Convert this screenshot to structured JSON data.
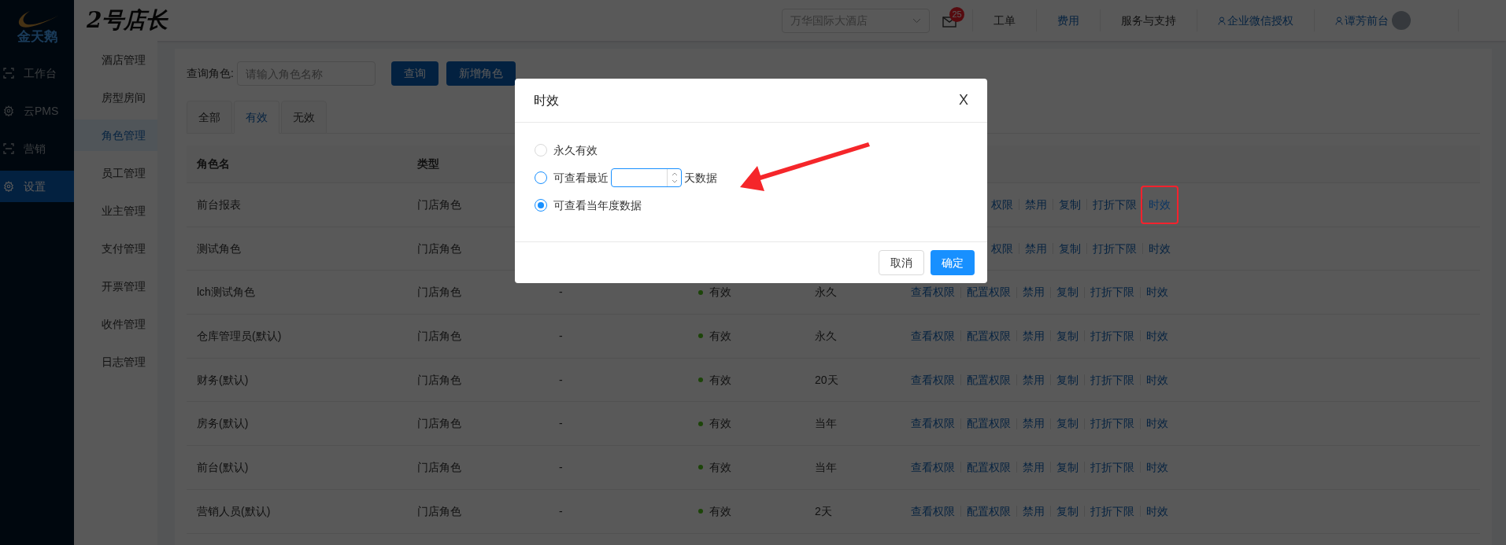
{
  "nav": {
    "logo_text": "金天鹅",
    "items": [
      {
        "label": "工作台",
        "kind": "scan",
        "selected": false
      },
      {
        "label": "云PMS",
        "kind": "gear",
        "selected": false
      },
      {
        "label": "营销",
        "kind": "scan",
        "selected": false
      },
      {
        "label": "设置",
        "kind": "gear",
        "selected": true
      }
    ]
  },
  "header": {
    "title": "2号店长",
    "hotel_select": "万华国际大酒店",
    "mail_badge": "25",
    "links": [
      {
        "label": "工单",
        "kind": "plain"
      },
      {
        "label": "费用",
        "kind": "link"
      },
      {
        "label": "服务与支持",
        "kind": "plain"
      },
      {
        "label": "企业微信授权",
        "kind": "user"
      },
      {
        "label": "谭芳前台",
        "kind": "user"
      }
    ]
  },
  "sub_menu": [
    {
      "label": "酒店管理",
      "selected": false
    },
    {
      "label": "房型房间",
      "selected": false
    },
    {
      "label": "角色管理",
      "selected": true
    },
    {
      "label": "员工管理",
      "selected": false
    },
    {
      "label": "业主管理",
      "selected": false
    },
    {
      "label": "支付管理",
      "selected": false
    },
    {
      "label": "开票管理",
      "selected": false
    },
    {
      "label": "收件管理",
      "selected": false
    },
    {
      "label": "日志管理",
      "selected": false
    }
  ],
  "search": {
    "label": "查询角色:",
    "placeholder": "请输入角色名称"
  },
  "buttons": [
    "查询",
    "新增角色"
  ],
  "tabs": [
    {
      "label": "全部",
      "selected": false
    },
    {
      "label": "有效",
      "selected": true
    },
    {
      "label": "无效",
      "selected": false
    }
  ],
  "table": {
    "columns": [
      "角色名",
      "类型"
    ],
    "rows": [
      {
        "name": "前台报表",
        "type": "门店角色",
        "actions": [
          {
            "label": "权限",
            "highlighted": false
          },
          {
            "label": "禁用",
            "highlighted": false
          },
          {
            "label": "复制",
            "highlighted": false
          },
          {
            "label": "打折下限",
            "highlighted": false
          },
          {
            "label": "时效",
            "highlighted": true
          }
        ]
      },
      {
        "name": "测试角色",
        "type": "门店角色",
        "actions": [
          {
            "label": "权限",
            "highlighted": false
          },
          {
            "label": "禁用",
            "highlighted": false
          },
          {
            "label": "复制",
            "highlighted": false
          },
          {
            "label": "打折下限",
            "highlighted": false
          },
          {
            "label": "时效",
            "highlighted": false
          }
        ]
      },
      {
        "name": "lch测试角色",
        "type": "门店角色",
        "column_3": "-",
        "status": "有效",
        "validity": "永久",
        "actions": [
          {
            "label": "查看权限",
            "highlighted": false
          },
          {
            "label": "配置权限",
            "highlighted": false
          },
          {
            "label": "禁用",
            "highlighted": false
          },
          {
            "label": "复制",
            "highlighted": false
          },
          {
            "label": "打折下限",
            "highlighted": false
          },
          {
            "label": "时效",
            "highlighted": false
          }
        ]
      },
      {
        "name": "仓库管理员(默认)",
        "type": "门店角色",
        "column_3": "-",
        "status": "有效",
        "validity": "永久",
        "actions": [
          {
            "label": "查看权限",
            "highlighted": false
          },
          {
            "label": "配置权限",
            "highlighted": false
          },
          {
            "label": "禁用",
            "highlighted": false
          },
          {
            "label": "复制",
            "highlighted": false
          },
          {
            "label": "打折下限",
            "highlighted": false
          },
          {
            "label": "时效",
            "highlighted": false
          }
        ]
      },
      {
        "name": "财务(默认)",
        "type": "门店角色",
        "column_3": "-",
        "status": "有效",
        "validity": "20天",
        "actions": [
          {
            "label": "查看权限",
            "highlighted": false
          },
          {
            "label": "配置权限",
            "highlighted": false
          },
          {
            "label": "禁用",
            "highlighted": false
          },
          {
            "label": "复制",
            "highlighted": false
          },
          {
            "label": "打折下限",
            "highlighted": false
          },
          {
            "label": "时效",
            "highlighted": false
          }
        ]
      },
      {
        "name": "房务(默认)",
        "type": "门店角色",
        "column_3": "-",
        "status": "有效",
        "validity": "当年",
        "actions": [
          {
            "label": "查看权限",
            "highlighted": false
          },
          {
            "label": "配置权限",
            "highlighted": false
          },
          {
            "label": "禁用",
            "highlighted": false
          },
          {
            "label": "复制",
            "highlighted": false
          },
          {
            "label": "打折下限",
            "highlighted": false
          },
          {
            "label": "时效",
            "highlighted": false
          }
        ]
      },
      {
        "name": "前台(默认)",
        "type": "门店角色",
        "column_3": "-",
        "status": "有效",
        "validity": "当年",
        "actions": [
          {
            "label": "查看权限",
            "highlighted": false
          },
          {
            "label": "配置权限",
            "highlighted": false
          },
          {
            "label": "禁用",
            "highlighted": false
          },
          {
            "label": "复制",
            "highlighted": false
          },
          {
            "label": "打折下限",
            "highlighted": false
          },
          {
            "label": "时效",
            "highlighted": false
          }
        ]
      },
      {
        "name": "营销人员(默认)",
        "type": "门店角色",
        "column_3": "-",
        "status": "有效",
        "validity": "2天",
        "actions": [
          {
            "label": "查看权限",
            "highlighted": false
          },
          {
            "label": "配置权限",
            "highlighted": false
          },
          {
            "label": "禁用",
            "highlighted": false
          },
          {
            "label": "复制",
            "highlighted": false
          },
          {
            "label": "打折下限",
            "highlighted": false
          },
          {
            "label": "时效",
            "highlighted": false
          }
        ]
      }
    ]
  },
  "modal": {
    "title": "时效",
    "close": "X",
    "options": [
      {
        "kind": "plain",
        "label": "永久有效",
        "selected": false
      },
      {
        "kind": "days",
        "label": "可查看最近",
        "suffix": "天数据",
        "selected": false
      },
      {
        "kind": "plain",
        "label": "可查看当年度数据",
        "selected": true
      }
    ],
    "buttons": [
      {
        "label": "取消",
        "kind": "default"
      },
      {
        "label": "确定",
        "kind": "primary"
      }
    ]
  }
}
